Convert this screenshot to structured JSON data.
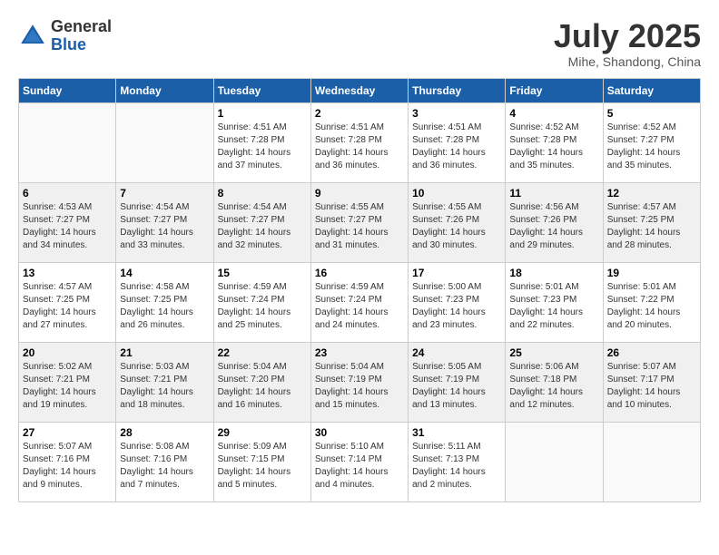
{
  "header": {
    "logo_general": "General",
    "logo_blue": "Blue",
    "month_year": "July 2025",
    "location": "Mihe, Shandong, China"
  },
  "weekdays": [
    "Sunday",
    "Monday",
    "Tuesday",
    "Wednesday",
    "Thursday",
    "Friday",
    "Saturday"
  ],
  "weeks": [
    [
      {
        "day": "",
        "sunrise": "",
        "sunset": "",
        "daylight": ""
      },
      {
        "day": "",
        "sunrise": "",
        "sunset": "",
        "daylight": ""
      },
      {
        "day": "1",
        "sunrise": "Sunrise: 4:51 AM",
        "sunset": "Sunset: 7:28 PM",
        "daylight": "Daylight: 14 hours and 37 minutes."
      },
      {
        "day": "2",
        "sunrise": "Sunrise: 4:51 AM",
        "sunset": "Sunset: 7:28 PM",
        "daylight": "Daylight: 14 hours and 36 minutes."
      },
      {
        "day": "3",
        "sunrise": "Sunrise: 4:51 AM",
        "sunset": "Sunset: 7:28 PM",
        "daylight": "Daylight: 14 hours and 36 minutes."
      },
      {
        "day": "4",
        "sunrise": "Sunrise: 4:52 AM",
        "sunset": "Sunset: 7:28 PM",
        "daylight": "Daylight: 14 hours and 35 minutes."
      },
      {
        "day": "5",
        "sunrise": "Sunrise: 4:52 AM",
        "sunset": "Sunset: 7:27 PM",
        "daylight": "Daylight: 14 hours and 35 minutes."
      }
    ],
    [
      {
        "day": "6",
        "sunrise": "Sunrise: 4:53 AM",
        "sunset": "Sunset: 7:27 PM",
        "daylight": "Daylight: 14 hours and 34 minutes."
      },
      {
        "day": "7",
        "sunrise": "Sunrise: 4:54 AM",
        "sunset": "Sunset: 7:27 PM",
        "daylight": "Daylight: 14 hours and 33 minutes."
      },
      {
        "day": "8",
        "sunrise": "Sunrise: 4:54 AM",
        "sunset": "Sunset: 7:27 PM",
        "daylight": "Daylight: 14 hours and 32 minutes."
      },
      {
        "day": "9",
        "sunrise": "Sunrise: 4:55 AM",
        "sunset": "Sunset: 7:27 PM",
        "daylight": "Daylight: 14 hours and 31 minutes."
      },
      {
        "day": "10",
        "sunrise": "Sunrise: 4:55 AM",
        "sunset": "Sunset: 7:26 PM",
        "daylight": "Daylight: 14 hours and 30 minutes."
      },
      {
        "day": "11",
        "sunrise": "Sunrise: 4:56 AM",
        "sunset": "Sunset: 7:26 PM",
        "daylight": "Daylight: 14 hours and 29 minutes."
      },
      {
        "day": "12",
        "sunrise": "Sunrise: 4:57 AM",
        "sunset": "Sunset: 7:25 PM",
        "daylight": "Daylight: 14 hours and 28 minutes."
      }
    ],
    [
      {
        "day": "13",
        "sunrise": "Sunrise: 4:57 AM",
        "sunset": "Sunset: 7:25 PM",
        "daylight": "Daylight: 14 hours and 27 minutes."
      },
      {
        "day": "14",
        "sunrise": "Sunrise: 4:58 AM",
        "sunset": "Sunset: 7:25 PM",
        "daylight": "Daylight: 14 hours and 26 minutes."
      },
      {
        "day": "15",
        "sunrise": "Sunrise: 4:59 AM",
        "sunset": "Sunset: 7:24 PM",
        "daylight": "Daylight: 14 hours and 25 minutes."
      },
      {
        "day": "16",
        "sunrise": "Sunrise: 4:59 AM",
        "sunset": "Sunset: 7:24 PM",
        "daylight": "Daylight: 14 hours and 24 minutes."
      },
      {
        "day": "17",
        "sunrise": "Sunrise: 5:00 AM",
        "sunset": "Sunset: 7:23 PM",
        "daylight": "Daylight: 14 hours and 23 minutes."
      },
      {
        "day": "18",
        "sunrise": "Sunrise: 5:01 AM",
        "sunset": "Sunset: 7:23 PM",
        "daylight": "Daylight: 14 hours and 22 minutes."
      },
      {
        "day": "19",
        "sunrise": "Sunrise: 5:01 AM",
        "sunset": "Sunset: 7:22 PM",
        "daylight": "Daylight: 14 hours and 20 minutes."
      }
    ],
    [
      {
        "day": "20",
        "sunrise": "Sunrise: 5:02 AM",
        "sunset": "Sunset: 7:21 PM",
        "daylight": "Daylight: 14 hours and 19 minutes."
      },
      {
        "day": "21",
        "sunrise": "Sunrise: 5:03 AM",
        "sunset": "Sunset: 7:21 PM",
        "daylight": "Daylight: 14 hours and 18 minutes."
      },
      {
        "day": "22",
        "sunrise": "Sunrise: 5:04 AM",
        "sunset": "Sunset: 7:20 PM",
        "daylight": "Daylight: 14 hours and 16 minutes."
      },
      {
        "day": "23",
        "sunrise": "Sunrise: 5:04 AM",
        "sunset": "Sunset: 7:19 PM",
        "daylight": "Daylight: 14 hours and 15 minutes."
      },
      {
        "day": "24",
        "sunrise": "Sunrise: 5:05 AM",
        "sunset": "Sunset: 7:19 PM",
        "daylight": "Daylight: 14 hours and 13 minutes."
      },
      {
        "day": "25",
        "sunrise": "Sunrise: 5:06 AM",
        "sunset": "Sunset: 7:18 PM",
        "daylight": "Daylight: 14 hours and 12 minutes."
      },
      {
        "day": "26",
        "sunrise": "Sunrise: 5:07 AM",
        "sunset": "Sunset: 7:17 PM",
        "daylight": "Daylight: 14 hours and 10 minutes."
      }
    ],
    [
      {
        "day": "27",
        "sunrise": "Sunrise: 5:07 AM",
        "sunset": "Sunset: 7:16 PM",
        "daylight": "Daylight: 14 hours and 9 minutes."
      },
      {
        "day": "28",
        "sunrise": "Sunrise: 5:08 AM",
        "sunset": "Sunset: 7:16 PM",
        "daylight": "Daylight: 14 hours and 7 minutes."
      },
      {
        "day": "29",
        "sunrise": "Sunrise: 5:09 AM",
        "sunset": "Sunset: 7:15 PM",
        "daylight": "Daylight: 14 hours and 5 minutes."
      },
      {
        "day": "30",
        "sunrise": "Sunrise: 5:10 AM",
        "sunset": "Sunset: 7:14 PM",
        "daylight": "Daylight: 14 hours and 4 minutes."
      },
      {
        "day": "31",
        "sunrise": "Sunrise: 5:11 AM",
        "sunset": "Sunset: 7:13 PM",
        "daylight": "Daylight: 14 hours and 2 minutes."
      },
      {
        "day": "",
        "sunrise": "",
        "sunset": "",
        "daylight": ""
      },
      {
        "day": "",
        "sunrise": "",
        "sunset": "",
        "daylight": ""
      }
    ]
  ]
}
